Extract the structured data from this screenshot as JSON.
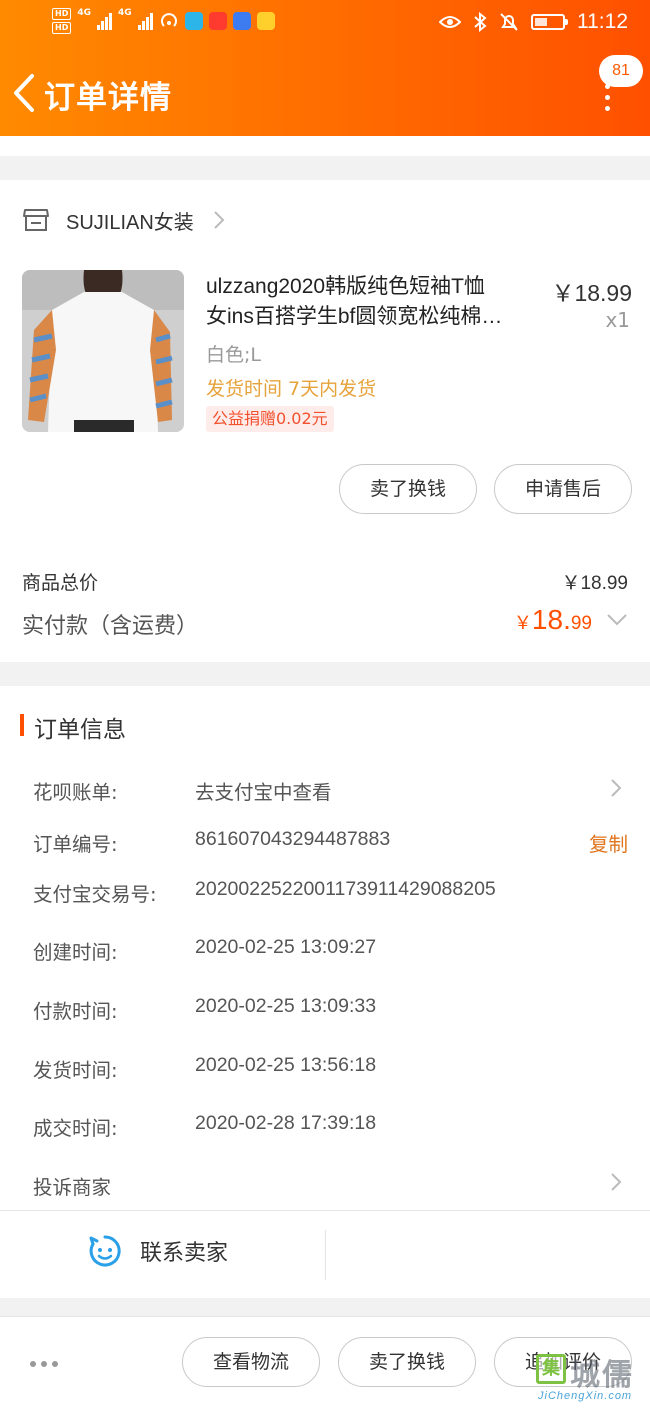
{
  "status_bar": {
    "network": "4G",
    "network2": "4G",
    "time": "11:12"
  },
  "header": {
    "title": "订单详情",
    "notification_count": "81"
  },
  "shop": {
    "name": "SUJILIAN女装"
  },
  "product": {
    "title_line1": "ulzzang2020韩版纯色短袖T恤",
    "title_line2": "女ins百搭学生bf圆领宽松纯棉…",
    "price": "￥18.99",
    "quantity": "x1",
    "sku": "白色;L",
    "shipping": "发货时间  7天内发货",
    "charity": "公益捐赠0.02元"
  },
  "item_actions": {
    "sell_label": "卖了换钱",
    "after_sale_label": "申请售后"
  },
  "summary": {
    "goods_total_label": "商品总价",
    "goods_total_value": "￥18.99",
    "paid_label": "实付款（含运费）",
    "paid_currency": "￥",
    "paid_integer": "18.",
    "paid_decimal": "99"
  },
  "order_info": {
    "section_title": "订单信息",
    "rows": [
      {
        "label": "花呗账单:",
        "value": "去支付宝中查看"
      },
      {
        "label": "订单编号:",
        "value": "861607043294487883"
      },
      {
        "label": "支付宝交易号:",
        "value": "2020022522001173911429088205"
      },
      {
        "label": "创建时间:",
        "value": "2020-02-25 13:09:27"
      },
      {
        "label": "付款时间:",
        "value": "2020-02-25 13:09:33"
      },
      {
        "label": "发货时间:",
        "value": "2020-02-25 13:56:18"
      },
      {
        "label": "成交时间:",
        "value": "2020-02-28 17:39:18"
      }
    ],
    "copy_label": "复制",
    "complaint_label": "投诉商家",
    "contact_label": "联系卖家"
  },
  "bottom_bar": {
    "logistics_label": "查看物流",
    "sell_label": "卖了换钱",
    "review_label": "追加评价"
  },
  "watermark": {
    "box_char": "集",
    "cn": "城儒",
    "en": "JiChengXin.com"
  },
  "colors": {
    "brand_orange": "#ff5000",
    "shipping_yellow": "#e7a33b",
    "copy_orange": "#e0751e",
    "contact_blue": "#2aa0e8"
  }
}
